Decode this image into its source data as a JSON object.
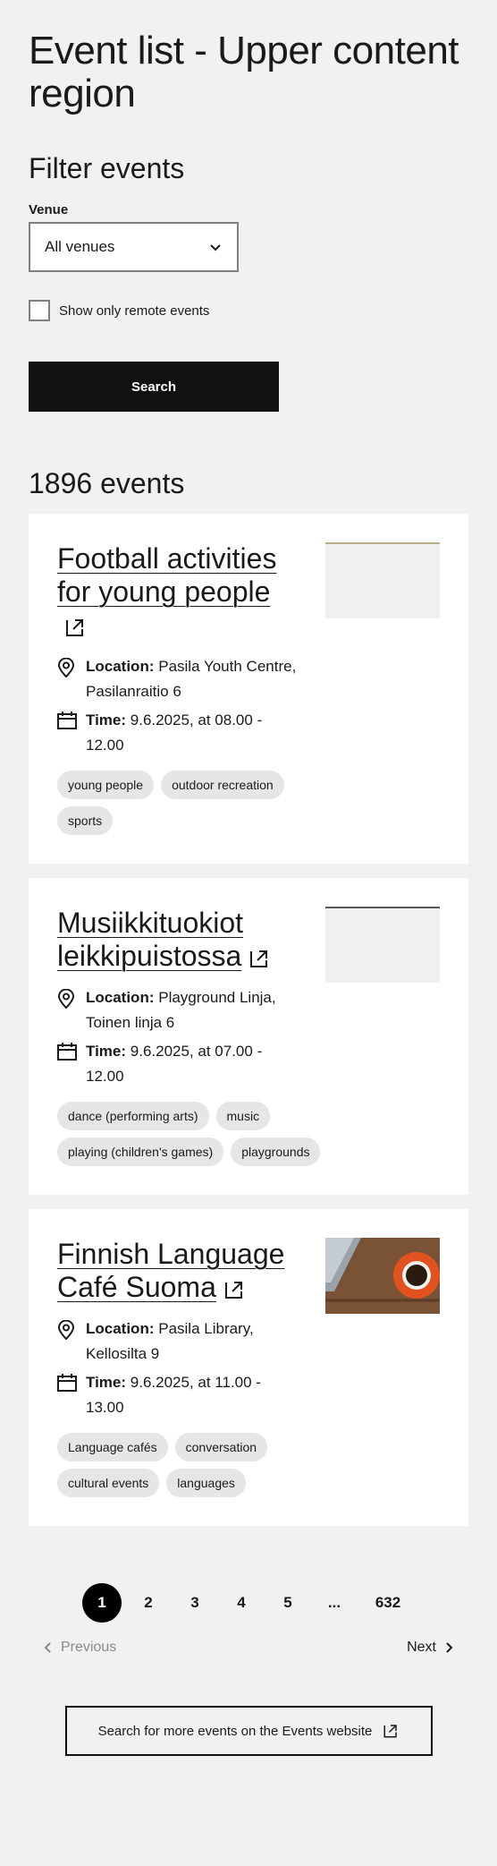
{
  "page": {
    "title": "Event list - Upper content region"
  },
  "filters": {
    "title": "Filter events",
    "venue_label": "Venue",
    "venue_value": "All venues",
    "remote_label": "Show only remote events",
    "search_label": "Search"
  },
  "results": {
    "count_text": "1896 events"
  },
  "events": [
    {
      "title": "Football activities for young people",
      "location_label": "Location:",
      "location": "Pasila Youth Centre, Pasilanraitio 6",
      "time_label": "Time:",
      "time": "9.6.2025, at 08.00 - 12.00",
      "tags": [
        "young people",
        "outdoor recreation",
        "sports"
      ]
    },
    {
      "title": "Musiikkituokiot leikkipuistossa",
      "location_label": "Location:",
      "location": "Playground Linja, Toinen linja 6",
      "time_label": "Time:",
      "time": "9.6.2025, at 07.00 - 12.00",
      "tags": [
        "dance (performing arts)",
        "music",
        "playing (children's games)",
        "playgrounds"
      ]
    },
    {
      "title": "Finnish Language Café Suoma",
      "location_label": "Location:",
      "location": "Pasila Library, Kellosilta 9",
      "time_label": "Time:",
      "time": "9.6.2025, at 11.00 - 13.00",
      "tags": [
        "Language cafés",
        "conversation",
        "cultural events",
        "languages"
      ]
    }
  ],
  "pagination": {
    "pages": [
      "1",
      "2",
      "3",
      "4",
      "5",
      "...",
      "632"
    ],
    "current": "1",
    "previous_label": "Previous",
    "next_label": "Next"
  },
  "more_events_label": "Search for more events on the Events website",
  "icons": {
    "location": "location-pin-icon",
    "time": "calendar-icon",
    "external": "external-link-icon",
    "select": "chevron-down-icon"
  }
}
